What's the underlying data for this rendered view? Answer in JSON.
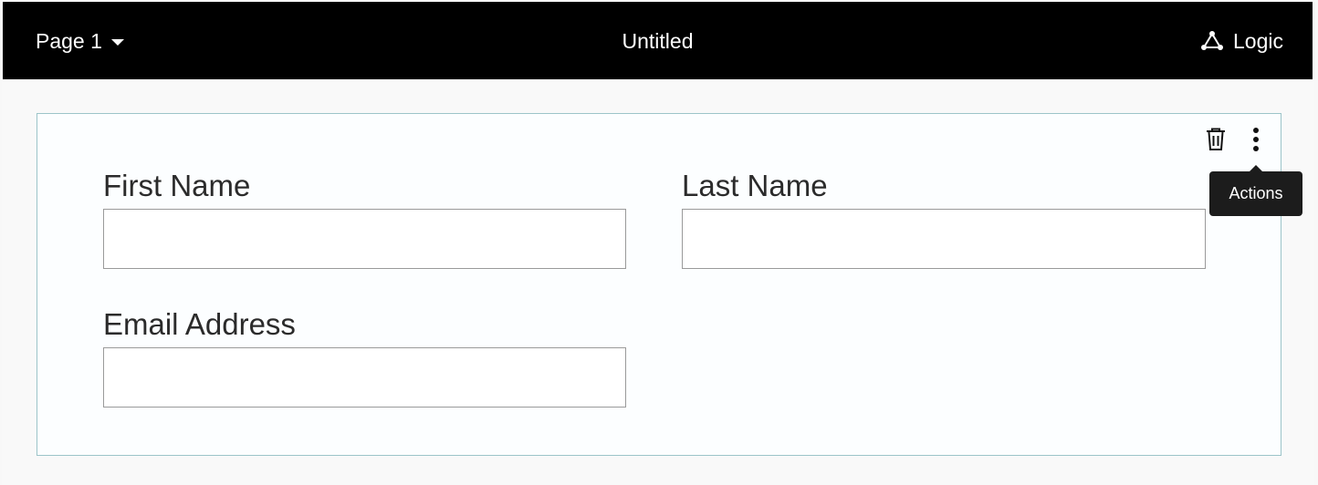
{
  "header": {
    "page_selector": "Page 1",
    "title": "Untitled",
    "logic_label": "Logic",
    "logic_icon": "logic-graph-icon",
    "caret_icon": "caret-down-icon"
  },
  "card": {
    "delete_icon": "trash-icon",
    "actions_icon": "more-vertical-icon",
    "tooltip": "Actions",
    "fields": {
      "first_name": {
        "label": "First Name",
        "value": "",
        "placeholder": ""
      },
      "last_name": {
        "label": "Last Name",
        "value": "",
        "placeholder": ""
      },
      "email": {
        "label": "Email Address",
        "value": "",
        "placeholder": ""
      }
    }
  },
  "colors": {
    "header_bg": "#000000",
    "card_border": "#9cc4c9",
    "tooltip_bg": "#1c1c1c"
  }
}
